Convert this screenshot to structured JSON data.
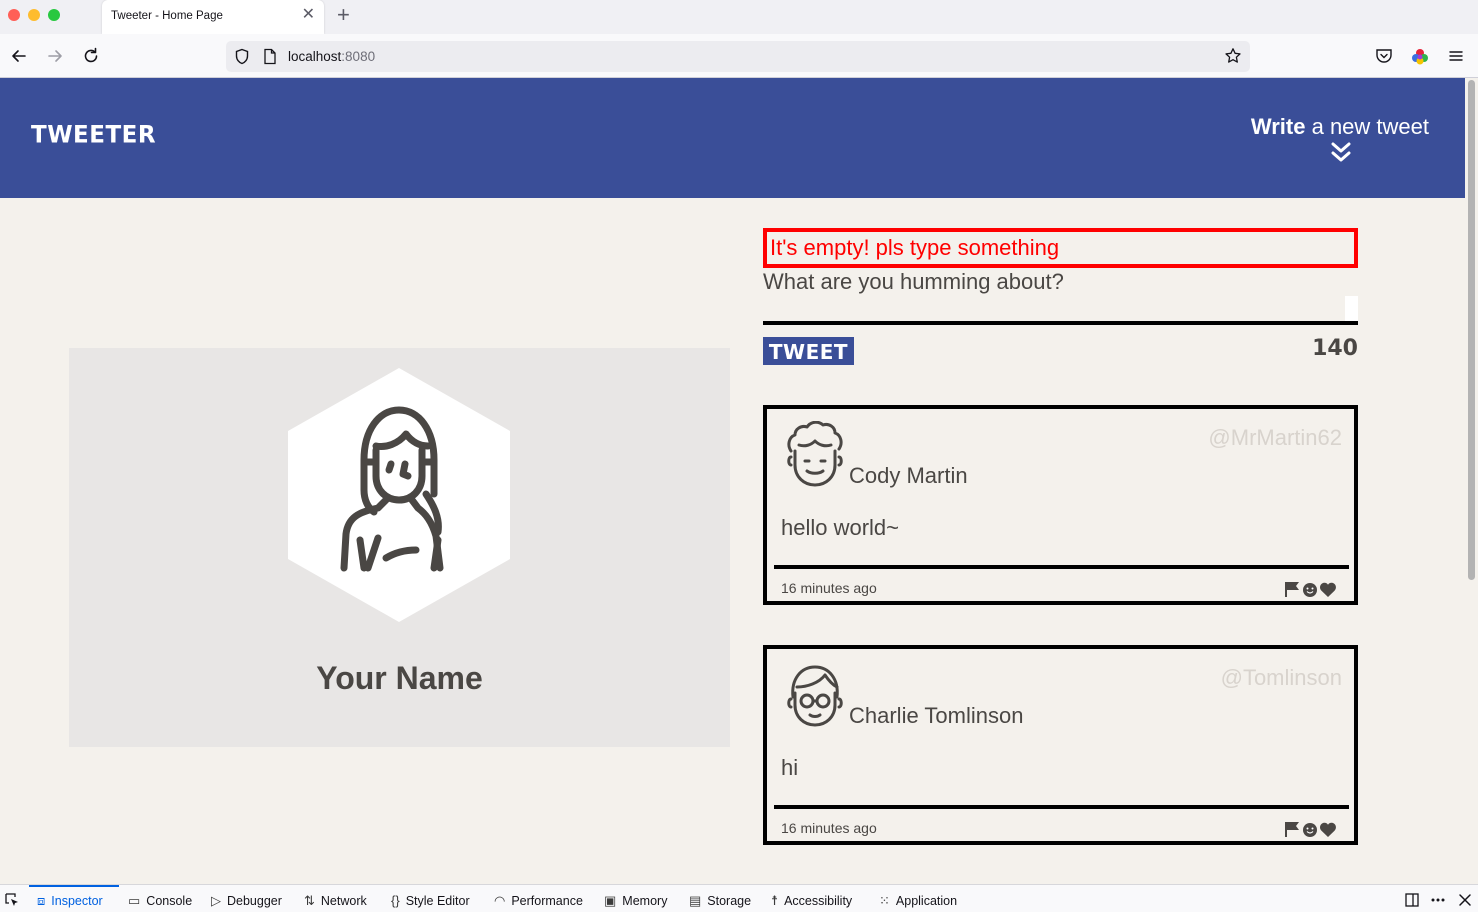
{
  "browser": {
    "tab_title": "Tweeter - Home Page",
    "tab_close": "✕",
    "new_tab": "+",
    "url_host": "localhost",
    "url_port": ":8080"
  },
  "header": {
    "logo": "TWEETER",
    "compose_toggle_bold": "Write",
    "compose_toggle_rest": " a new tweet"
  },
  "profile": {
    "name": "Your Name"
  },
  "compose": {
    "error": "It's empty! pls type something",
    "prompt": "What are you humming about?",
    "textarea_value": "",
    "tweet_button": "TWEET",
    "counter": "140"
  },
  "tweets": [
    {
      "handle": "@MrMartin62",
      "name": "Cody Martin",
      "body": "hello world~",
      "time": "16 minutes ago"
    },
    {
      "handle": "@Tomlinson",
      "name": "Charlie Tomlinson",
      "body": "hi",
      "time": "16 minutes ago"
    }
  ],
  "devtools": {
    "tabs": [
      "Inspector",
      "Console",
      "Debugger",
      "Network",
      "Style Editor",
      "Performance",
      "Memory",
      "Storage",
      "Accessibility",
      "Application"
    ],
    "active": "Inspector"
  },
  "colors": {
    "header_bg": "#3a4e98",
    "page_bg": "#f4f1ec",
    "error": "#ff0000",
    "text": "#4a4744"
  }
}
